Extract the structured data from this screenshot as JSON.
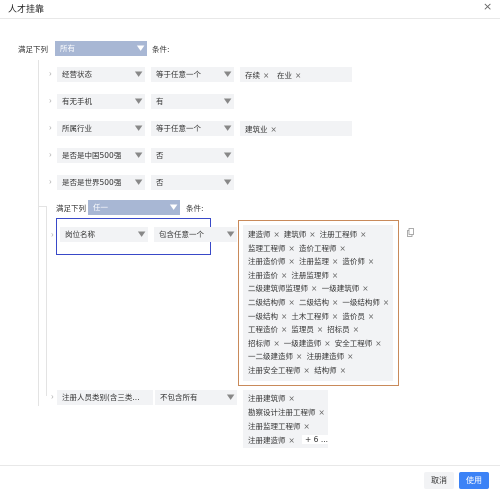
{
  "dialog": {
    "title": "人才挂靠",
    "close_icon": "×"
  },
  "root": {
    "label": "满足下列",
    "mode": "所有",
    "cond_label": "条件:"
  },
  "rows": [
    {
      "field": "经营状态",
      "op": "等于任意一个",
      "tags": [
        "存续",
        "在业"
      ]
    },
    {
      "field": "有无手机",
      "op": "有",
      "tags": []
    },
    {
      "field": "所属行业",
      "op": "等于任意一个",
      "tags": [
        "建筑业"
      ]
    },
    {
      "field": "是否是中国500强",
      "op": "否",
      "tags": []
    },
    {
      "field": "是否是世界500强",
      "op": "否",
      "tags": []
    }
  ],
  "group": {
    "label": "满足下列",
    "mode": "任一",
    "cond_label": "条件:",
    "rows": [
      {
        "field": "岗位名称",
        "op": "包含任意一个",
        "tags": [
          "建造师",
          "建筑师",
          "注册工程师",
          "监理工程师",
          "造价工程师",
          "注册造价师",
          "注册监理",
          "造价师",
          "注册造价",
          "注册监理师",
          "二级建筑师监理师",
          "一级建筑师",
          "二级结构师",
          "二级结构",
          "一级结构师",
          "一级结构",
          "土木工程师",
          "造价员",
          "工程造价",
          "监理员",
          "招标员",
          "招标师",
          "一级建造师",
          "安全工程师",
          "一二级建造师",
          "注册建造师",
          "注册安全工程师",
          "结构师"
        ]
      },
      {
        "field": "注册人员类别(含三类...",
        "op": "不包含所有",
        "tags": [
          "注册建筑师",
          "勘察设计注册工程师",
          "注册监理工程师",
          "注册建造师"
        ],
        "more": "+ 6 ..."
      }
    ]
  },
  "icons": {
    "dropdown": "▼",
    "expand": "›",
    "remove": "×",
    "copy": "copy-icon"
  },
  "footer": {
    "cancel": "取消",
    "use": "使用"
  },
  "colors": {
    "primary": "#3b82f6",
    "select_active": "#a8b7d4",
    "highlight_blue": "#3949c8",
    "highlight_orange": "#c98a5a"
  }
}
